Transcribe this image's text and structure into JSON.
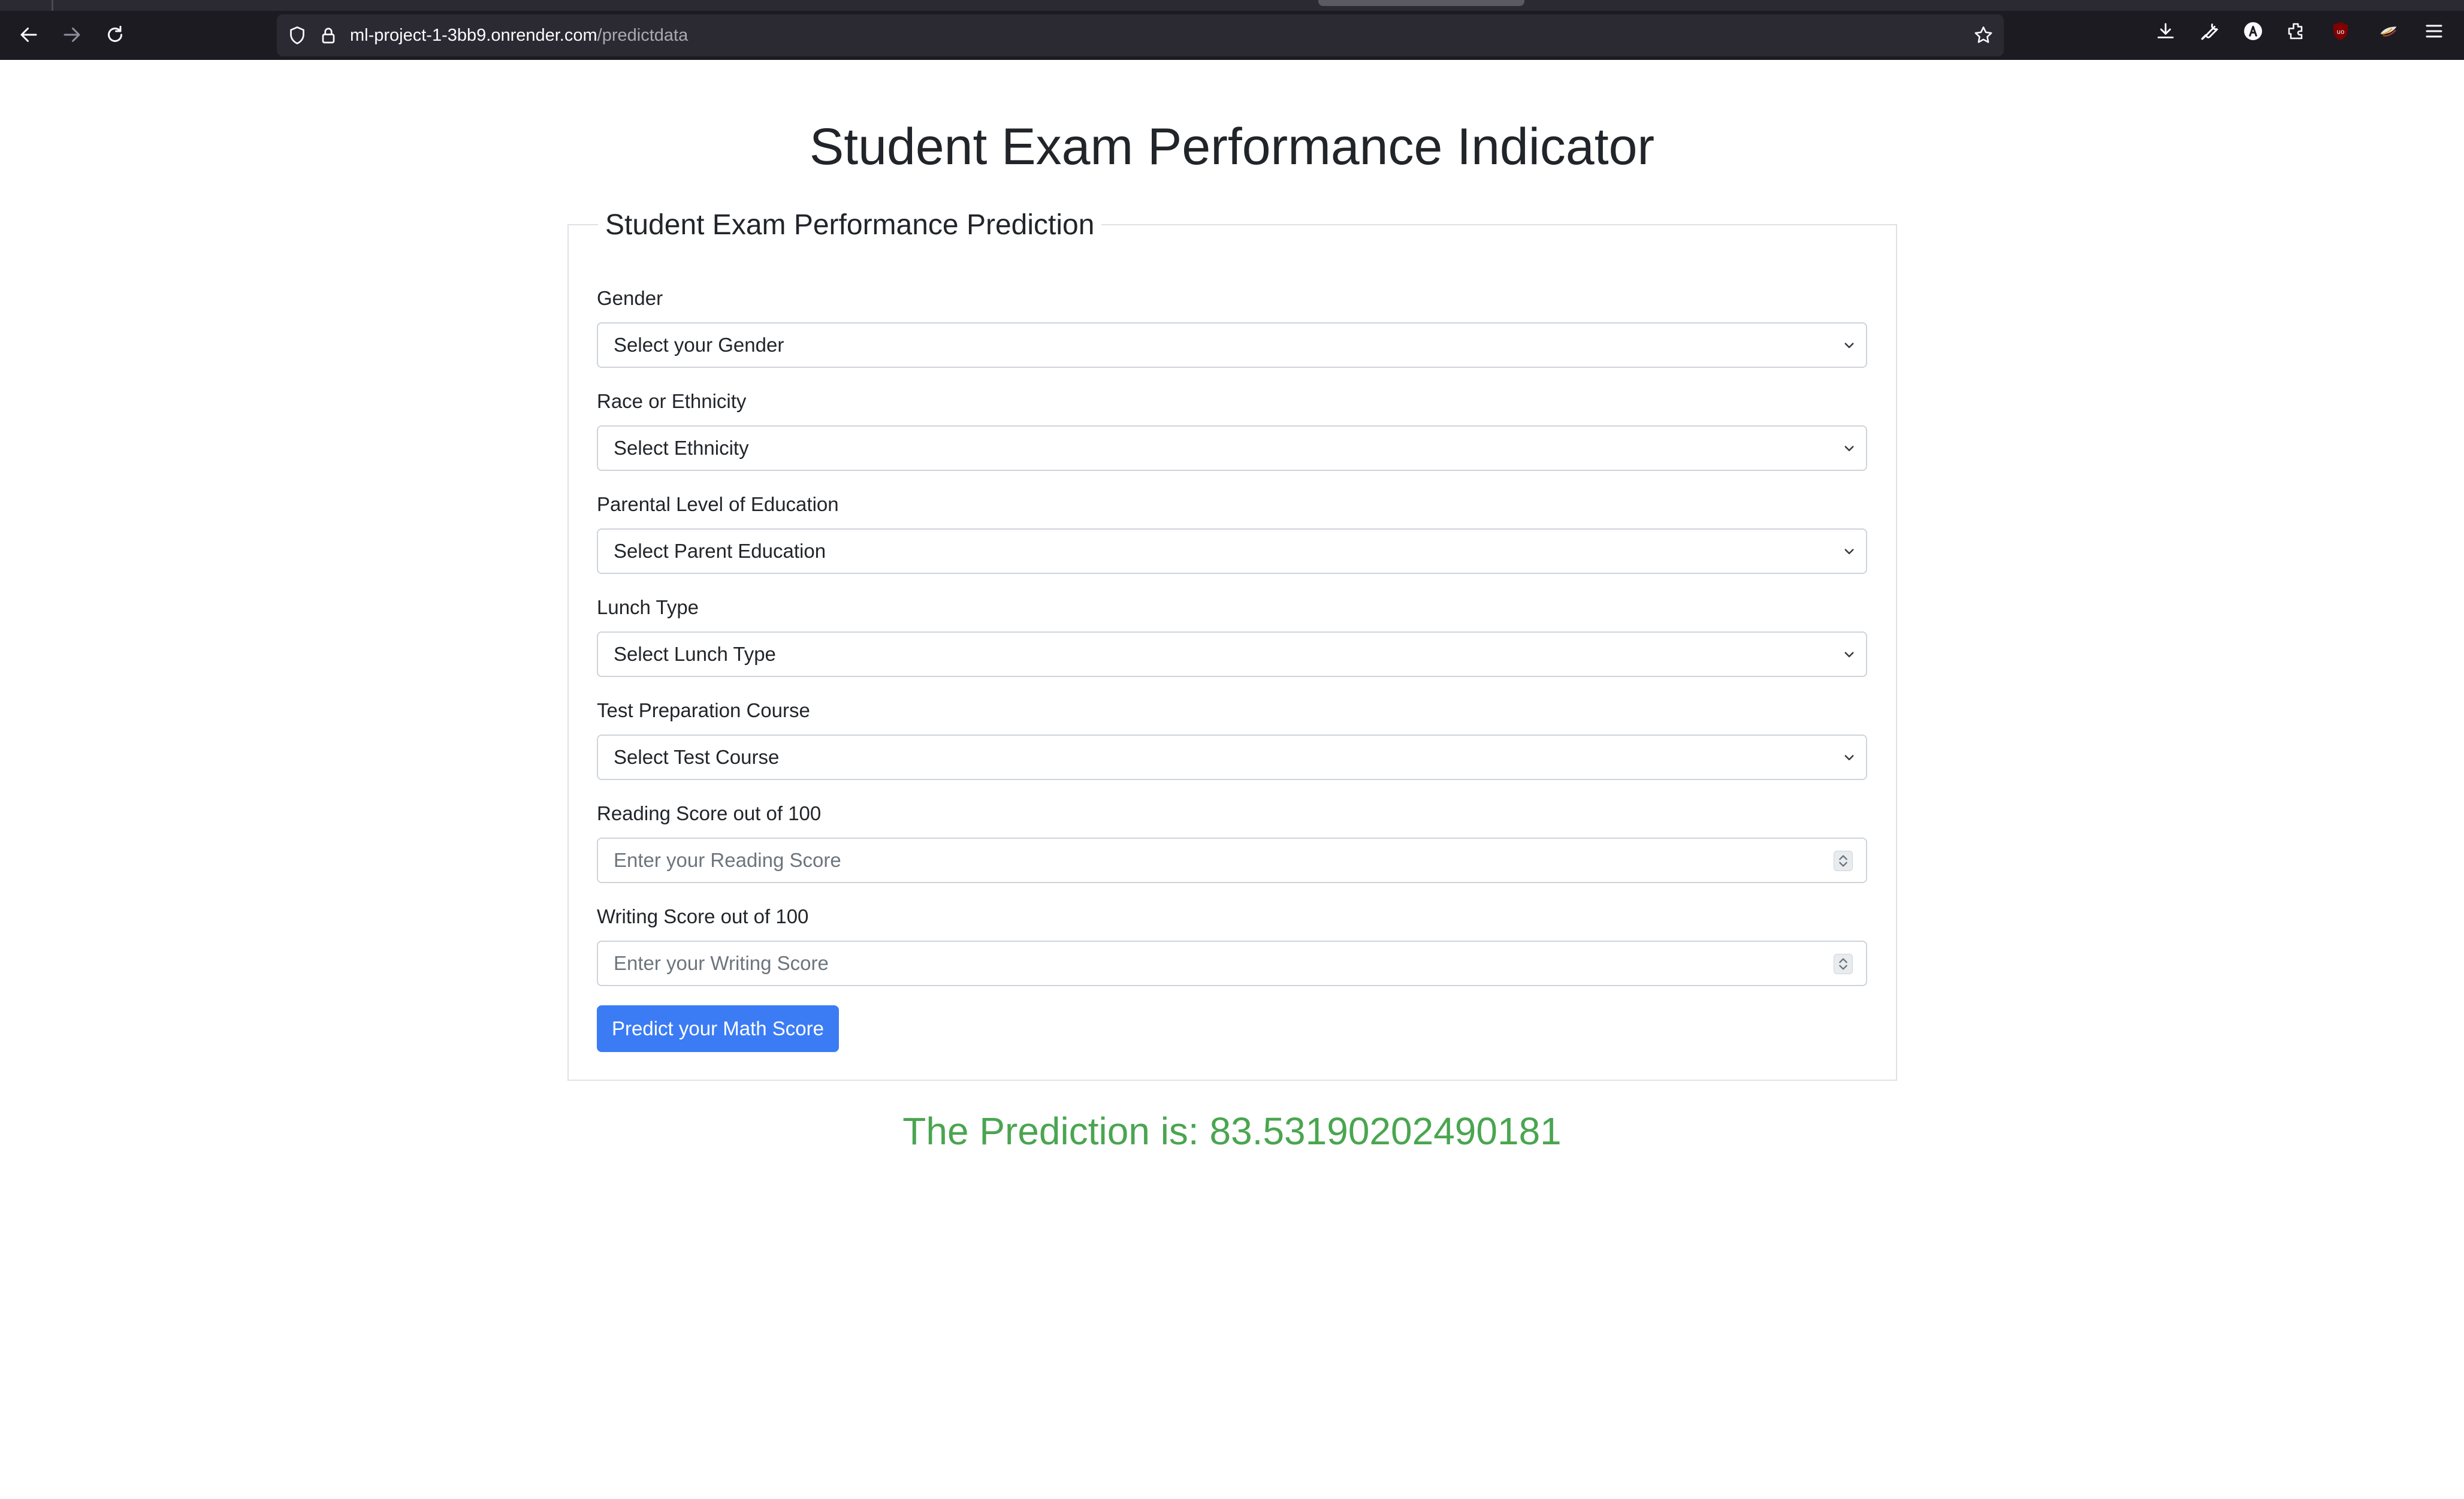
{
  "browser": {
    "url_host": "ml-project-1-3bb9.onrender.com",
    "url_path": "/predictdata",
    "icons": [
      "back-icon",
      "forward-icon",
      "reload-icon",
      "shield-icon",
      "lock-icon",
      "star-icon",
      "download-icon",
      "wrench-icon",
      "account-icon",
      "extensions-icon",
      "ublock-icon",
      "extension-icon",
      "menu-icon"
    ],
    "colors": {
      "chrome_bg": "#1c1b22",
      "urlbar_bg": "#2b2a33"
    }
  },
  "page": {
    "title": "Student Exam Performance Indicator",
    "legend": "Student Exam Performance Prediction",
    "fields": [
      {
        "label": "Gender",
        "type": "select",
        "value": "Select your Gender"
      },
      {
        "label": "Race or Ethnicity",
        "type": "select",
        "value": "Select Ethnicity"
      },
      {
        "label": "Parental Level of Education",
        "type": "select",
        "value": "Select Parent Education"
      },
      {
        "label": "Lunch Type",
        "type": "select",
        "value": "Select Lunch Type"
      },
      {
        "label": "Test Preparation Course",
        "type": "select",
        "value": "Select Test Course"
      },
      {
        "label": "Reading Score out of 100",
        "type": "number",
        "placeholder": "Enter your Reading Score"
      },
      {
        "label": "Writing Score out of 100",
        "type": "number",
        "placeholder": "Enter your Writing Score"
      }
    ],
    "submit_label": "Predict your Math Score",
    "result": "The Prediction is: 83.53190202490181",
    "colors": {
      "button": "#3b7cf5",
      "result": "#4aa550"
    }
  }
}
